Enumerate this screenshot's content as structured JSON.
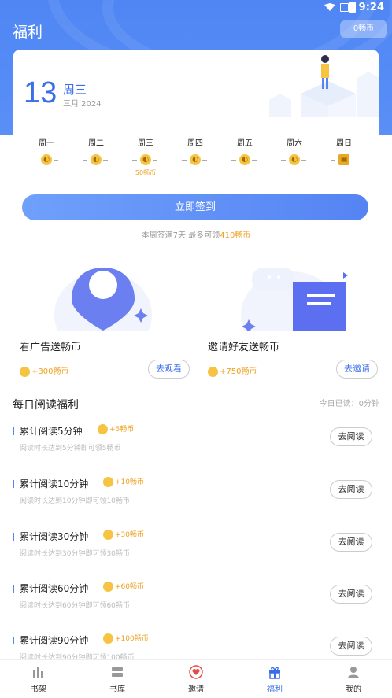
{
  "status": {
    "time": "9:24"
  },
  "header": {
    "title": "福利",
    "coin_balance": "0畅币"
  },
  "checkin": {
    "day": "13",
    "weekday": "周三",
    "month": "三月 2024",
    "week": [
      {
        "name": "周一",
        "icon": "coin-icon",
        "reward": ""
      },
      {
        "name": "周二",
        "icon": "coin-icon",
        "reward": ""
      },
      {
        "name": "周三",
        "icon": "coin-icon",
        "reward": "50畅币"
      },
      {
        "name": "周四",
        "icon": "coin-icon",
        "reward": ""
      },
      {
        "name": "周五",
        "icon": "coin-icon",
        "reward": ""
      },
      {
        "name": "周六",
        "icon": "coin-icon",
        "reward": ""
      },
      {
        "name": "周日",
        "icon": "gift-icon",
        "reward": ""
      }
    ],
    "button": "立即签到",
    "note_prefix": "本周签满7天 最多可领",
    "note_highlight": "410畅币"
  },
  "promos": [
    {
      "title": "看广告送畅币",
      "reward": "+300畅币",
      "button": "去观看"
    },
    {
      "title": "邀请好友送畅币",
      "reward": "+750畅币",
      "button": "去邀请"
    }
  ],
  "reading": {
    "title": "每日阅读福利",
    "today": "今日已读：0分钟",
    "tasks": [
      {
        "title": "累计阅读5分钟",
        "reward": "+5畅币",
        "desc": "阅读时长达到5分钟即可领5畅币",
        "button": "去阅读"
      },
      {
        "title": "累计阅读10分钟",
        "reward": "+10畅币",
        "desc": "阅读时长达到10分钟即可领10畅币",
        "button": "去阅读"
      },
      {
        "title": "累计阅读30分钟",
        "reward": "+30畅币",
        "desc": "阅读时长达到30分钟即可领30畅币",
        "button": "去阅读"
      },
      {
        "title": "累计阅读60分钟",
        "reward": "+60畅币",
        "desc": "阅读时长达到60分钟即可领60畅币",
        "button": "去阅读"
      },
      {
        "title": "累计阅读90分钟",
        "reward": "+100畅币",
        "desc": "阅读时长达到90分钟即可领100畅币",
        "button": "去阅读"
      }
    ]
  },
  "nav": [
    {
      "label": "书架",
      "icon": "bookshelf-icon"
    },
    {
      "label": "书库",
      "icon": "library-icon"
    },
    {
      "label": "邀请",
      "icon": "heart-icon"
    },
    {
      "label": "福利",
      "icon": "gift-icon",
      "active": true
    },
    {
      "label": "我的",
      "icon": "profile-icon"
    }
  ],
  "colors": {
    "accent": "#5584f3",
    "coin": "#f6c343",
    "reward": "#f0a020"
  }
}
